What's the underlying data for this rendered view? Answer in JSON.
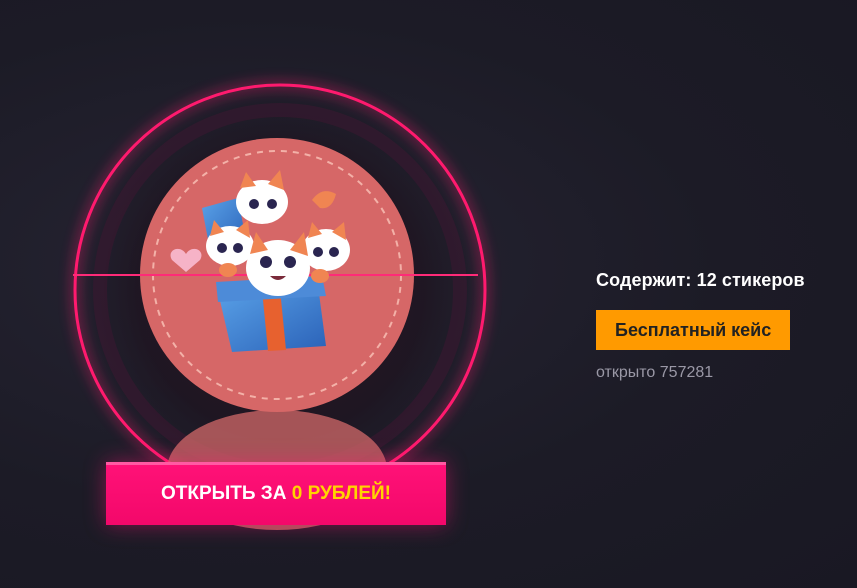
{
  "case": {
    "contains_text": "Содержит: 12 стикеров",
    "badge_label": "Бесплатный кейс",
    "opened_text": "открыто 757281"
  },
  "open_button": {
    "prefix": "ОТКРЫТЬ ЗА ",
    "price": "0 РУБЛЕЙ!"
  },
  "colors": {
    "background": "#1c1b26",
    "neon_ring": "#ff1a6e",
    "badge": "#ff9a00",
    "button": "#ff0e73",
    "price_accent": "#ffd400",
    "opened_text": "#9a98a6"
  }
}
